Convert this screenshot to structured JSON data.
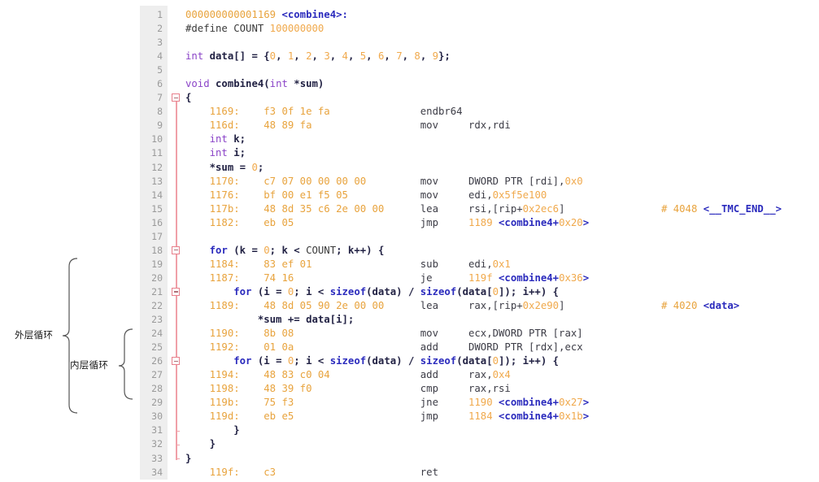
{
  "annotations": {
    "outer_loop_label": "外层循环",
    "inner_loop_label": "内层循环",
    "brace_color": "#555555"
  },
  "editor": {
    "gutter_bg": "#eeeeee",
    "gutter_fg": "#9a9a9a",
    "fold_color": "#e8808c",
    "first_line": 1,
    "last_line": 34,
    "fold_marker_lines": [
      7,
      18,
      21,
      26
    ],
    "fold_tick_lines": [
      31,
      32,
      33
    ],
    "line_numbers": [
      1,
      2,
      3,
      4,
      5,
      6,
      7,
      8,
      9,
      10,
      11,
      12,
      13,
      14,
      15,
      16,
      17,
      18,
      19,
      20,
      21,
      22,
      23,
      24,
      25,
      26,
      27,
      28,
      29,
      30,
      31,
      32,
      33,
      34
    ]
  },
  "colors": {
    "address_orange": "#e8a33d",
    "literal_orange": "#f0a94c",
    "symbol_navy": "#2b2bbd",
    "keyword_purple": "#8b44c8",
    "asm_gray": "#3c3c46",
    "background": "#ffffff"
  },
  "code_lines": [
    {
      "n": 1,
      "type": "asm_header",
      "text": "000000000001169 <combine4>:",
      "addr": "000000000001169",
      "symbol": "<combine4>:"
    },
    {
      "n": 2,
      "type": "c",
      "text": "#define COUNT 100000000"
    },
    {
      "n": 3,
      "type": "blank",
      "text": ""
    },
    {
      "n": 4,
      "type": "c",
      "text": "int data[] = {0, 1, 2, 3, 4, 5, 6, 7, 8, 9};"
    },
    {
      "n": 5,
      "type": "blank",
      "text": ""
    },
    {
      "n": 6,
      "type": "c",
      "text": "void combine4(int *sum)"
    },
    {
      "n": 7,
      "type": "c",
      "text": "{"
    },
    {
      "n": 8,
      "type": "asm",
      "addr": "1169:",
      "bytes": "f3 0f 1e fa",
      "mnemonic": "endbr64",
      "operands": "",
      "comment": ""
    },
    {
      "n": 9,
      "type": "asm",
      "addr": "116d:",
      "bytes": "48 89 fa",
      "mnemonic": "mov",
      "operands": "rdx,rdi",
      "comment": ""
    },
    {
      "n": 10,
      "type": "c",
      "text": "int k;"
    },
    {
      "n": 11,
      "type": "c",
      "text": "int i;"
    },
    {
      "n": 12,
      "type": "c",
      "text": "*sum = 0;"
    },
    {
      "n": 13,
      "type": "asm",
      "addr": "1170:",
      "bytes": "c7 07 00 00 00 00",
      "mnemonic": "mov",
      "operands": "DWORD PTR [rdi],0x0",
      "comment": ""
    },
    {
      "n": 14,
      "type": "asm",
      "addr": "1176:",
      "bytes": "bf 00 e1 f5 05",
      "mnemonic": "mov",
      "operands": "edi,0x5f5e100",
      "comment": ""
    },
    {
      "n": 15,
      "type": "asm",
      "addr": "117b:",
      "bytes": "48 8d 35 c6 2e 00 00",
      "mnemonic": "lea",
      "operands": "rsi,[rip+0x2ec6]",
      "comment": "# 4048 <__TMC_END__>"
    },
    {
      "n": 16,
      "type": "asm",
      "addr": "1182:",
      "bytes": "eb 05",
      "mnemonic": "jmp",
      "operands": "1189 <combine4+0x20>",
      "comment": ""
    },
    {
      "n": 17,
      "type": "blank",
      "text": ""
    },
    {
      "n": 18,
      "type": "c",
      "text": "for (k = 0; k < COUNT; k++) {"
    },
    {
      "n": 19,
      "type": "asm",
      "addr": "1184:",
      "bytes": "83 ef 01",
      "mnemonic": "sub",
      "operands": "edi,0x1",
      "comment": ""
    },
    {
      "n": 20,
      "type": "asm",
      "addr": "1187:",
      "bytes": "74 16",
      "mnemonic": "je",
      "operands": "119f <combine4+0x36>",
      "comment": ""
    },
    {
      "n": 21,
      "type": "c",
      "text": "for (i = 0; i < sizeof(data) / sizeof(data[0]); i++) {"
    },
    {
      "n": 22,
      "type": "asm",
      "addr": "1189:",
      "bytes": "48 8d 05 90 2e 00 00",
      "mnemonic": "lea",
      "operands": "rax,[rip+0x2e90]",
      "comment": "# 4020 <data>"
    },
    {
      "n": 23,
      "type": "c",
      "text": "*sum += data[i];"
    },
    {
      "n": 24,
      "type": "asm",
      "addr": "1190:",
      "bytes": "8b 08",
      "mnemonic": "mov",
      "operands": "ecx,DWORD PTR [rax]",
      "comment": ""
    },
    {
      "n": 25,
      "type": "asm",
      "addr": "1192:",
      "bytes": "01 0a",
      "mnemonic": "add",
      "operands": "DWORD PTR [rdx],ecx",
      "comment": ""
    },
    {
      "n": 26,
      "type": "c",
      "text": "for (i = 0; i < sizeof(data) / sizeof(data[0]); i++) {"
    },
    {
      "n": 27,
      "type": "asm",
      "addr": "1194:",
      "bytes": "48 83 c0 04",
      "mnemonic": "add",
      "operands": "rax,0x4",
      "comment": ""
    },
    {
      "n": 28,
      "type": "asm",
      "addr": "1198:",
      "bytes": "48 39 f0",
      "mnemonic": "cmp",
      "operands": "rax,rsi",
      "comment": ""
    },
    {
      "n": 29,
      "type": "asm",
      "addr": "119b:",
      "bytes": "75 f3",
      "mnemonic": "jne",
      "operands": "1190 <combine4+0x27>",
      "comment": ""
    },
    {
      "n": 30,
      "type": "asm",
      "addr": "119d:",
      "bytes": "eb e5",
      "mnemonic": "jmp",
      "operands": "1184 <combine4+0x1b>",
      "comment": ""
    },
    {
      "n": 31,
      "type": "c",
      "text": "}"
    },
    {
      "n": 32,
      "type": "c",
      "text": "}"
    },
    {
      "n": 33,
      "type": "c",
      "text": "}"
    },
    {
      "n": 34,
      "type": "asm",
      "addr": "119f:",
      "bytes": "c3",
      "mnemonic": "ret",
      "operands": "",
      "comment": ""
    }
  ]
}
